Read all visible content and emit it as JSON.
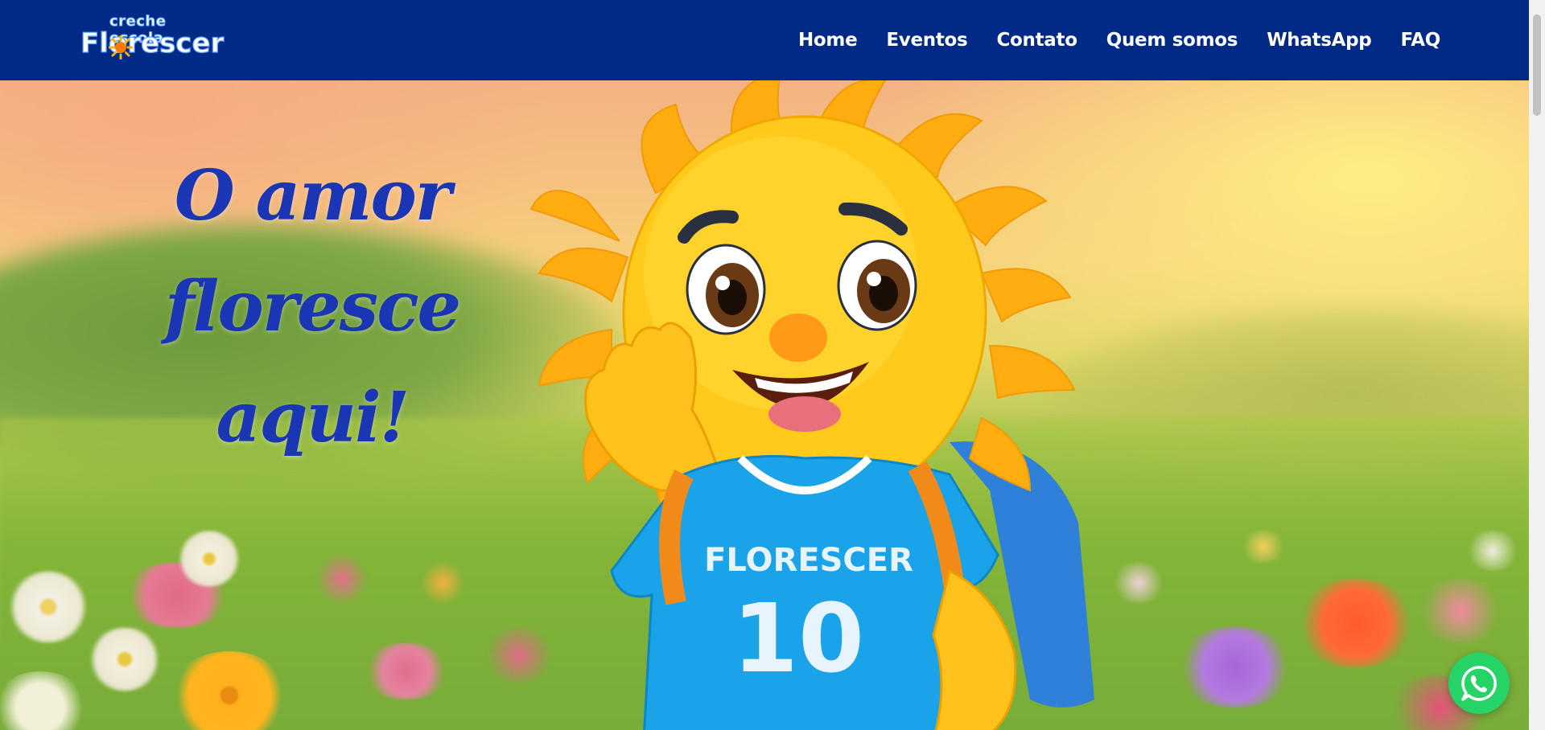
{
  "logo": {
    "top_text": "creche escola",
    "main_text": "Florescer",
    "sun_icon": "sun-icon"
  },
  "nav": {
    "items": [
      {
        "label": "Home"
      },
      {
        "label": "Eventos"
      },
      {
        "label": "Contato"
      },
      {
        "label": "Quem somos"
      },
      {
        "label": "WhatsApp"
      },
      {
        "label": "FAQ"
      }
    ]
  },
  "hero": {
    "headline_line1": "O amor floresce",
    "headline_line2": "aqui!",
    "mascot_shirt_text": "FLORESCER",
    "mascot_shirt_number": "10"
  },
  "floating": {
    "whatsapp_icon": "whatsapp-icon"
  },
  "colors": {
    "navbar": "#002a85",
    "headline": "#1a36b4",
    "whatsapp": "#25d366",
    "shirt": "#1aa3e8",
    "sun": "#ffc81e"
  }
}
